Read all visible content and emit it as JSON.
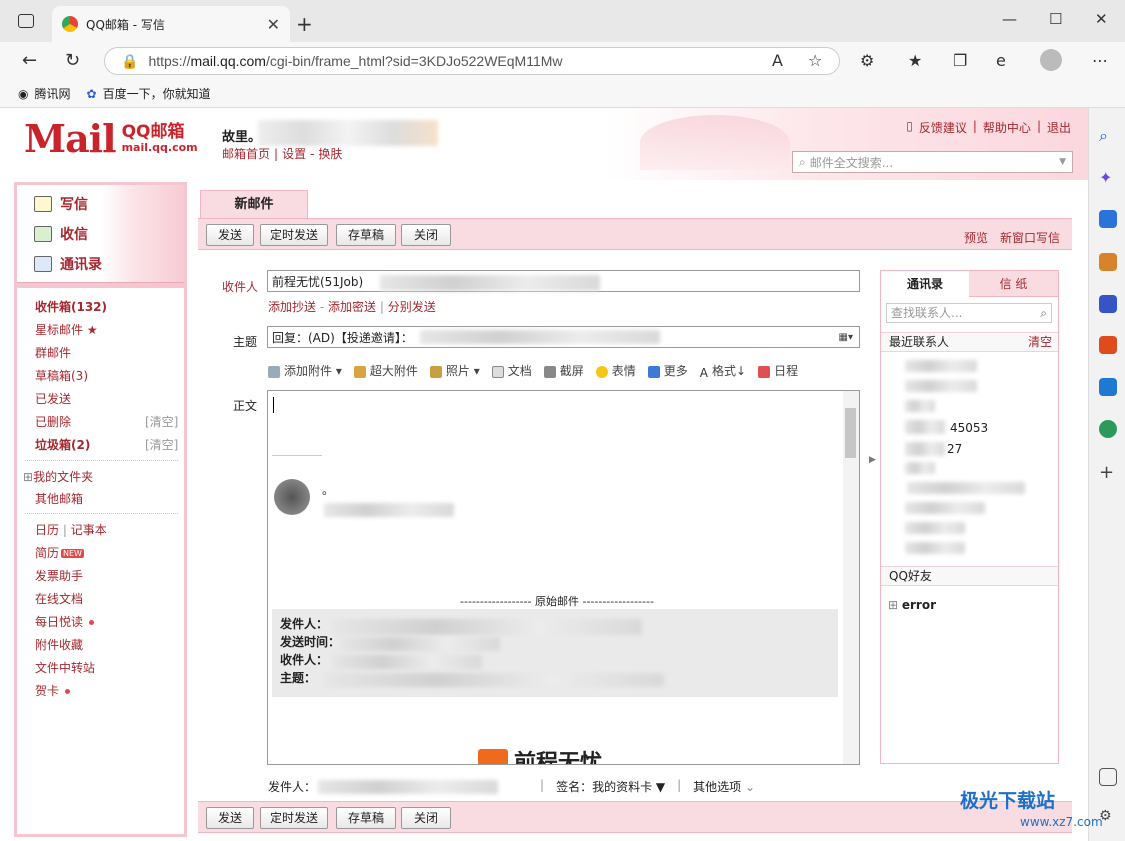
{
  "browser": {
    "tab_title": "QQ邮箱 - 写信",
    "url_scheme": "https://",
    "url_host": "mail.qq.com",
    "url_path": "/cgi-bin/frame_html?sid=3KDJo522WEqM11Mw",
    "bookmarks": [
      {
        "label": "腾讯网"
      },
      {
        "label": "百度一下，你就知道"
      }
    ]
  },
  "header": {
    "brand_main": "Mail",
    "brand_name": "QQ邮箱",
    "brand_domain": "mail.qq.com",
    "user_name": "故里。",
    "user_links": [
      "邮箱首页",
      "|",
      "设置",
      "-",
      "换肤"
    ],
    "top_links": [
      "反馈建议",
      "|",
      "帮助中心",
      "|",
      "退出"
    ],
    "search_placeholder": "邮件全文搜索..."
  },
  "sidebar": {
    "compose": "写信",
    "receive": "收信",
    "contacts": "通讯录",
    "folders": [
      {
        "label": "收件箱(132)",
        "bold": true
      },
      {
        "label": "星标邮件 ★"
      },
      {
        "label": "群邮件"
      },
      {
        "label": "草稿箱(3)"
      },
      {
        "label": "已发送"
      },
      {
        "label": "已删除",
        "extra": "[清空]"
      },
      {
        "label": "垃圾箱(2)",
        "bold": true,
        "extra": "[清空]"
      }
    ],
    "my_folders": "我的文件夹",
    "other_mail": "其他邮箱",
    "calendar": "日历",
    "notebook": "记事本",
    "apps": [
      "简历",
      "发票助手",
      "在线文档",
      "每日悦读",
      "附件收藏",
      "文件中转站",
      "贺卡"
    ],
    "new_badge": "NEW"
  },
  "compose": {
    "tab": "新邮件",
    "buttons": {
      "send": "发送",
      "scheduled": "定时发送",
      "draft": "存草稿",
      "close": "关闭"
    },
    "preview": "预览",
    "new_window": "新窗口写信",
    "to_label": "收件人",
    "to_value": "前程无忧(51Job)",
    "to_links": [
      "添加抄送",
      "-",
      "添加密送",
      "|",
      "分别发送"
    ],
    "subject_label": "主题",
    "subject_value": "回复：(AD)【投递邀请】：",
    "body_label": "正文",
    "tools": [
      "添加附件",
      "超大附件",
      "照片",
      "文档",
      "截屏",
      "表情",
      "更多",
      "格式",
      "日程"
    ],
    "original_divider": "------------------ 原始邮件 ------------------",
    "hdr_from": "发件人：",
    "hdr_time": "发送时间：",
    "hdr_to": "收件人：",
    "hdr_subject": "主题：",
    "sender_label": "发件人：",
    "signature": "签名：我的资料卡 ▼",
    "other_options": "其他选项",
    "logo_text": "前程无忧",
    "dot_text": "。"
  },
  "contacts_panel": {
    "tab_contacts": "通讯录",
    "tab_stationery": "信 纸",
    "search_placeholder": "查找联系人...",
    "recent": "最近联系人",
    "clear": "清空",
    "partial_1": "45053",
    "partial_2": "27",
    "qq_friends": "QQ好友",
    "group": "error"
  },
  "watermark": {
    "brand": "极光下载站",
    "site": "www.xz7.com"
  },
  "colors": {
    "accent": "#a6282f",
    "pink": "#f9dce2",
    "pink_border": "#f0b7c2"
  }
}
